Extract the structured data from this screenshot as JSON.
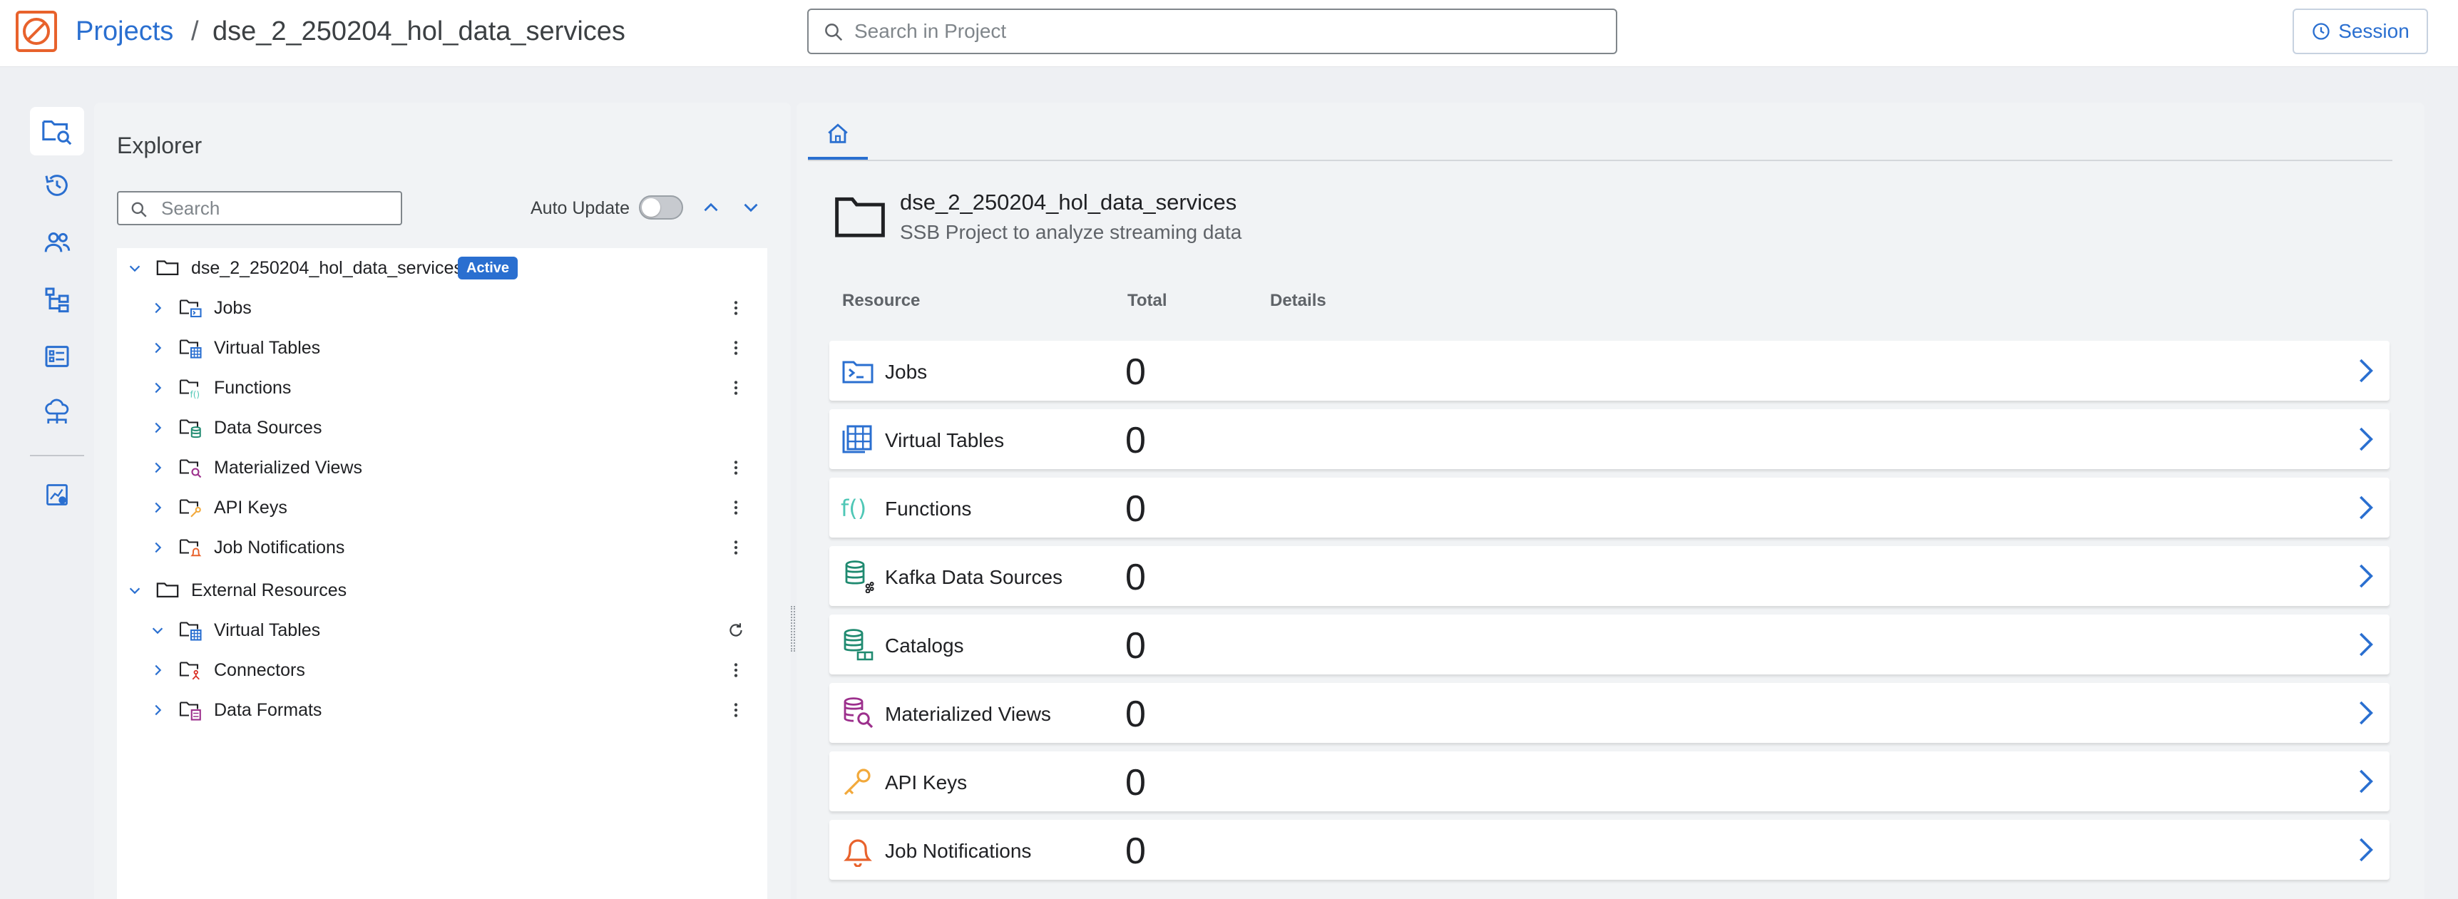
{
  "header": {
    "logo_icon": "ssb-logo-icon",
    "breadcrumb_root": "Projects",
    "breadcrumb_sep": "/",
    "breadcrumb_current": "dse_2_250204_hol_data_services",
    "search_placeholder": "Search in Project",
    "session_label": "Session",
    "accent": "#2a6fd0",
    "logo_color": "#e8622c"
  },
  "rail": {
    "items": [
      {
        "icon": "explorer-icon",
        "active": true
      },
      {
        "icon": "history-icon"
      },
      {
        "icon": "users-icon"
      },
      {
        "icon": "hierarchy-icon"
      },
      {
        "icon": "form-icon"
      },
      {
        "icon": "cloud-network-icon"
      },
      {
        "icon": "dashboard-settings-icon"
      }
    ]
  },
  "explorer": {
    "title": "Explorer",
    "search_placeholder": "Search",
    "auto_update_label": "Auto Update",
    "auto_update_on": false,
    "tree": [
      {
        "label": "dse_2_250204_hol_data_services",
        "level": 0,
        "expanded": true,
        "badge": "Active"
      },
      {
        "label": "Jobs",
        "level": 1,
        "menu": true
      },
      {
        "label": "Virtual Tables",
        "level": 1,
        "menu": true
      },
      {
        "label": "Functions",
        "level": 1,
        "menu": true
      },
      {
        "label": "Data Sources",
        "level": 1,
        "menu": false
      },
      {
        "label": "Materialized Views",
        "level": 1,
        "menu": true
      },
      {
        "label": "API Keys",
        "level": 1,
        "menu": true
      },
      {
        "label": "Job Notifications",
        "level": 1,
        "menu": true
      },
      {
        "label": "External Resources",
        "level": 0,
        "expanded": true
      },
      {
        "label": "Virtual Tables",
        "level": 1,
        "expanded": true,
        "refresh": true
      },
      {
        "label": "Connectors",
        "level": 1,
        "menu": true
      },
      {
        "label": "Data Formats",
        "level": 1,
        "menu": true
      }
    ]
  },
  "main": {
    "home_tab_icon": "home-icon",
    "project_name": "dse_2_250204_hol_data_services",
    "project_description": "SSB Project to analyze streaming data",
    "columns": {
      "resource": "Resource",
      "total": "Total",
      "details": "Details"
    },
    "resources": [
      {
        "name": "Jobs",
        "total": "0",
        "icon": "jobs-icon",
        "color": "#2a6fd0"
      },
      {
        "name": "Virtual Tables",
        "total": "0",
        "icon": "virtual-tables-icon",
        "color": "#2a6fd0"
      },
      {
        "name": "Functions",
        "total": "0",
        "icon": "functions-icon",
        "color": "#4fc7b6"
      },
      {
        "name": "Kafka Data Sources",
        "total": "0",
        "icon": "kafka-data-sources-icon",
        "color": "#1f8a70"
      },
      {
        "name": "Catalogs",
        "total": "0",
        "icon": "catalogs-icon",
        "color": "#1f8a70"
      },
      {
        "name": "Materialized Views",
        "total": "0",
        "icon": "materialized-views-icon",
        "color": "#9c2f8c"
      },
      {
        "name": "API Keys",
        "total": "0",
        "icon": "api-keys-icon",
        "color": "#f2a93b"
      },
      {
        "name": "Job Notifications",
        "total": "0",
        "icon": "job-notifications-icon",
        "color": "#e8622c"
      }
    ]
  }
}
